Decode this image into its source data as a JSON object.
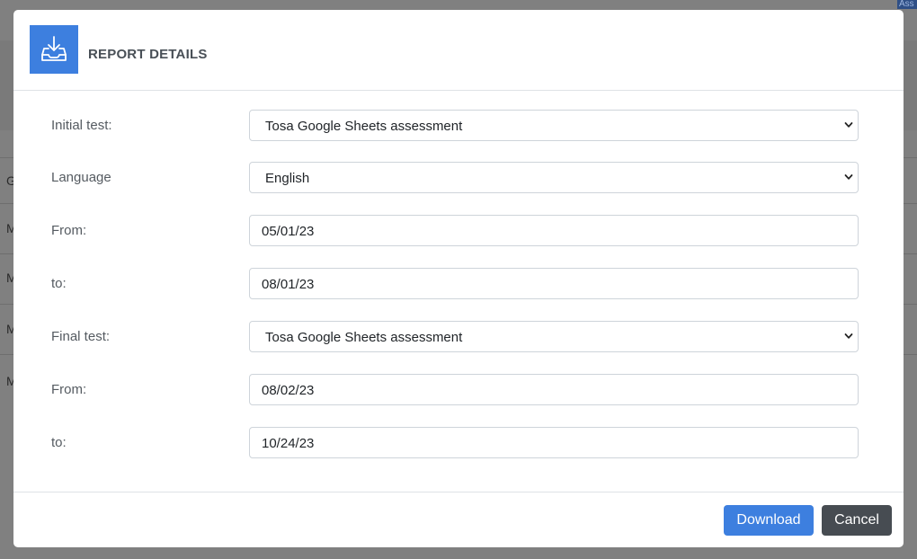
{
  "background": {
    "row_letters": [
      "G",
      "M",
      "M",
      "M",
      "M"
    ],
    "badge_text": "Ass"
  },
  "modal": {
    "icon": "download-tray-icon",
    "title": "REPORT DETAILS",
    "fields": [
      {
        "label": "Initial test:",
        "type": "select",
        "value": "Tosa Google Sheets assessment"
      },
      {
        "label": "Language",
        "type": "select",
        "value": "English"
      },
      {
        "label": "From:",
        "type": "input",
        "value": "05/01/23"
      },
      {
        "label": "to:",
        "type": "input",
        "value": "08/01/23"
      },
      {
        "label": "Final test:",
        "type": "select",
        "value": "Tosa Google Sheets assessment"
      },
      {
        "label": "From:",
        "type": "input",
        "value": "08/02/23"
      },
      {
        "label": "to:",
        "type": "input",
        "value": "10/24/23"
      }
    ],
    "footer": {
      "download_label": "Download",
      "cancel_label": "Cancel"
    }
  },
  "colors": {
    "primary": "#3d7fdf",
    "secondary": "#474c52",
    "overlay": "#808080"
  }
}
